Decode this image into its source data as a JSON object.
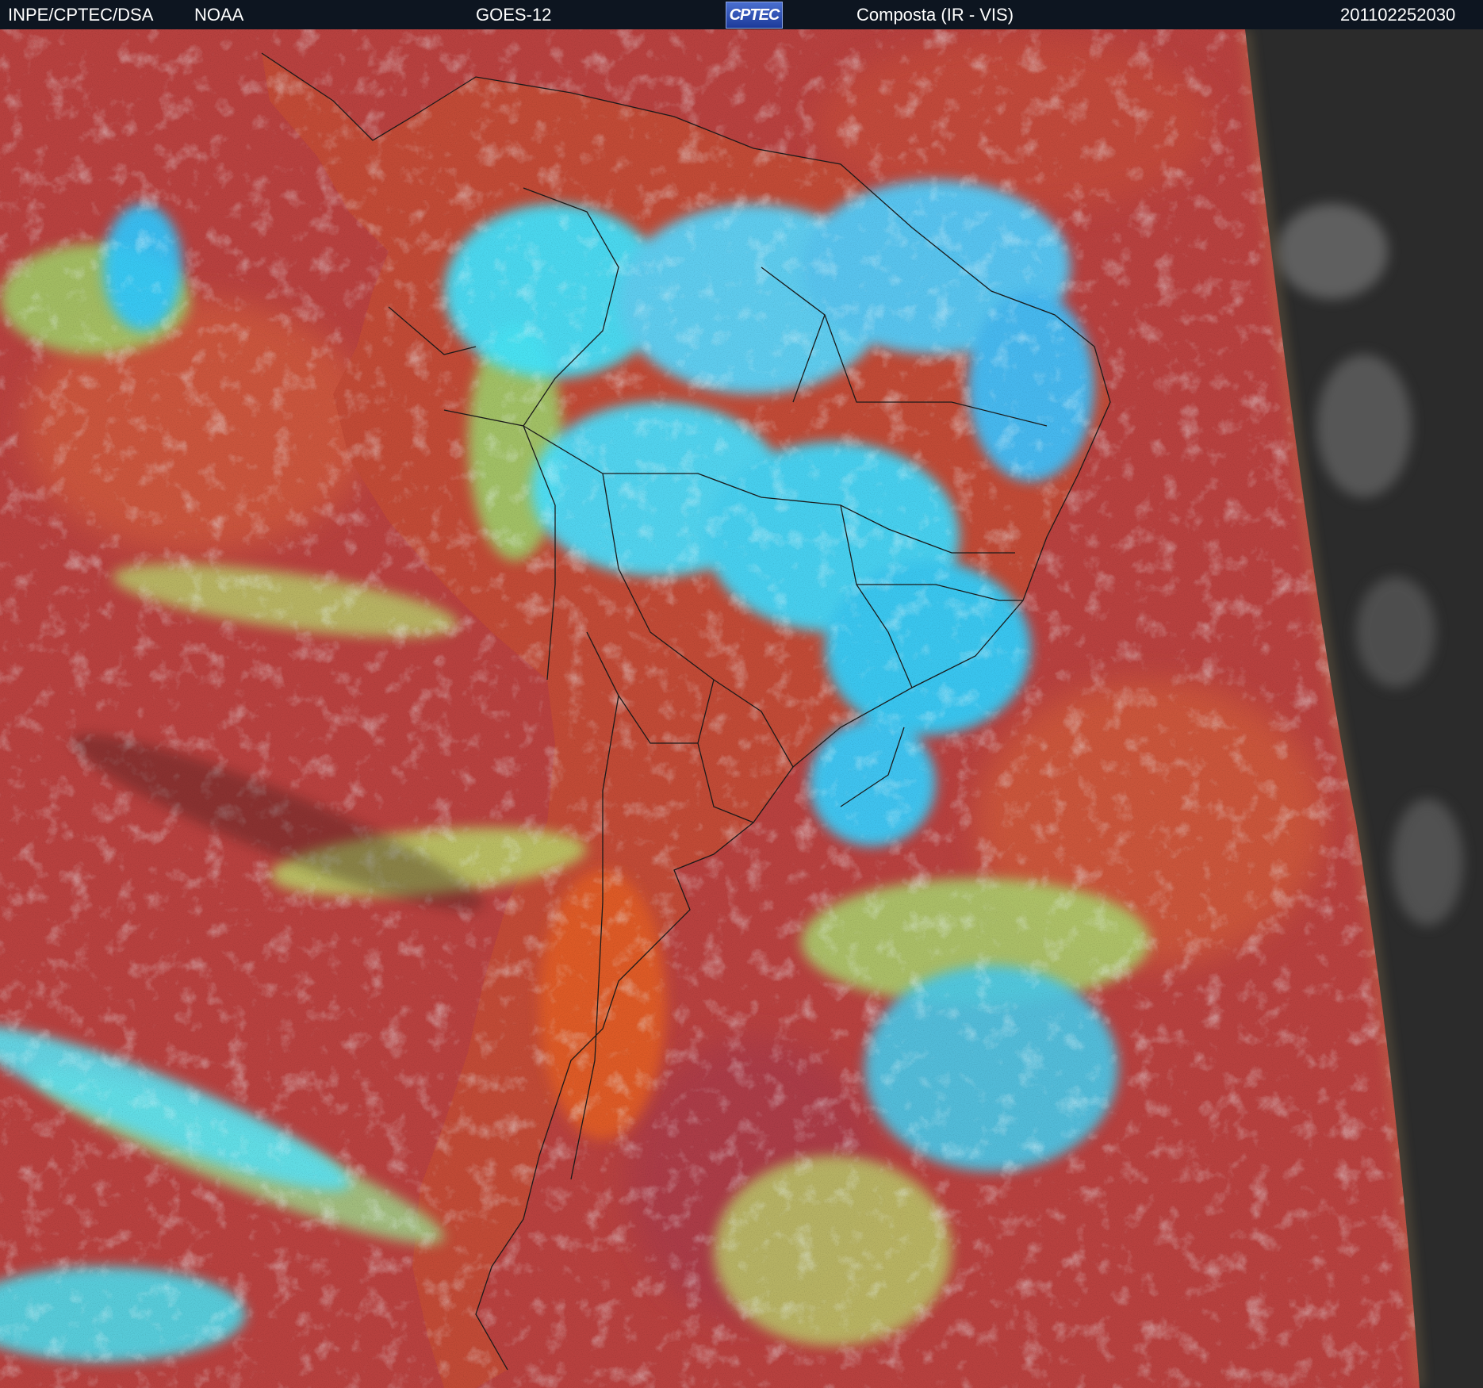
{
  "header": {
    "agency": "INPE/CPTEC/DSA",
    "source": "NOAA",
    "satellite": "GOES-12",
    "logo_text": "CPTEC",
    "product": "Composta (IR - VIS)",
    "timestamp": "201102252030"
  },
  "colors": {
    "header_bg": "#0d1520",
    "ocean_clear": "#b8413f",
    "land_clear": "#d2522e",
    "cold_cloud": "#3fe4ff",
    "mid_cloud": "#9be06a",
    "night_side": "#2a2a2a",
    "border_lines": "#1a1a1a"
  }
}
